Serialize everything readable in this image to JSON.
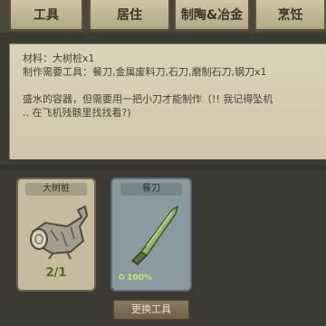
{
  "tabs": [
    {
      "label": "工具"
    },
    {
      "label": "居住"
    },
    {
      "label": "制陶&冶金"
    },
    {
      "label": "烹饪"
    }
  ],
  "description": {
    "material": "材料：大树桩x1",
    "tools": "制作需要工具：餐刀,金属废料刀,石刀,磨制石刀,钢刀x1",
    "line1": "盛水的容器，但需要用一把小刀才能制作（!! 我记得坠机",
    "line2": ".. 在飞机残骸里找找看?)"
  },
  "material_card": {
    "title": "大树桩",
    "count": "2/1",
    "icon": "tree-stump-icon"
  },
  "tool_card": {
    "title": "餐刀",
    "durability": "100%",
    "icon": "knife-icon"
  },
  "swap_button": "更换工具",
  "colors": {
    "count_green": "#566b1f",
    "durability_green": "#c9e86a",
    "panel_parchment": "#d6ccb3"
  }
}
